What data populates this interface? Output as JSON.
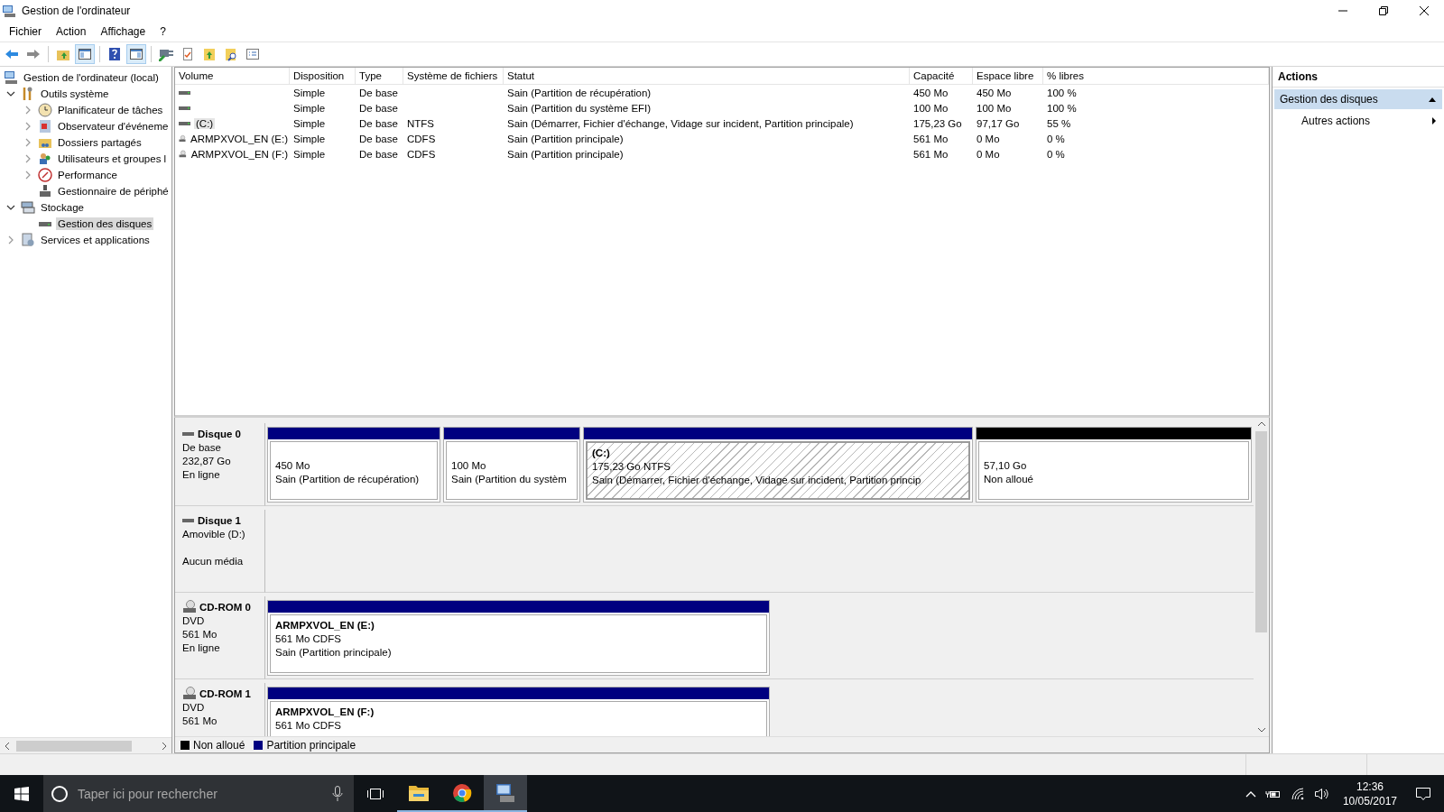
{
  "window": {
    "title": "Gestion de l'ordinateur"
  },
  "menu": [
    "Fichier",
    "Action",
    "Affichage",
    "?"
  ],
  "toolbar": [
    [
      {
        "kind": "back",
        "pressed": false
      },
      {
        "kind": "forward",
        "pressed": false
      }
    ],
    [
      {
        "kind": "up",
        "pressed": false
      },
      {
        "kind": "tree",
        "pressed": true
      }
    ],
    [
      {
        "kind": "help",
        "pressed": false
      },
      {
        "kind": "pane",
        "pressed": true
      }
    ],
    [
      {
        "kind": "connect",
        "pressed": false
      },
      {
        "kind": "check",
        "pressed": false
      },
      {
        "kind": "export",
        "pressed": false
      },
      {
        "kind": "find",
        "pressed": false
      },
      {
        "kind": "props",
        "pressed": false
      }
    ]
  ],
  "tree": [
    {
      "label": "Gestion de l'ordinateur (local)",
      "kind": "computer",
      "selected": false,
      "children": [
        {
          "label": "Outils système",
          "kind": "tools",
          "expanded": true,
          "selected": false,
          "children": [
            {
              "label": "Planificateur de tâches",
              "kind": "clock",
              "expanded": false,
              "selected": false
            },
            {
              "label": "Observateur d'événeme",
              "kind": "event",
              "expanded": false,
              "selected": false
            },
            {
              "label": "Dossiers partagés",
              "kind": "shared",
              "expanded": false,
              "selected": false
            },
            {
              "label": "Utilisateurs et groupes l",
              "kind": "users",
              "expanded": false,
              "selected": false
            },
            {
              "label": "Performance",
              "kind": "performance",
              "expanded": false,
              "selected": false
            },
            {
              "label": "Gestionnaire de périphé",
              "kind": "device",
              "selected": false
            }
          ]
        },
        {
          "label": "Stockage",
          "kind": "storage",
          "expanded": true,
          "selected": false,
          "children": [
            {
              "label": "Gestion des disques",
              "kind": "disk",
              "selected": true
            }
          ]
        },
        {
          "label": "Services et applications",
          "kind": "services",
          "expanded": false,
          "selected": false
        }
      ]
    }
  ],
  "table": {
    "columns": [
      "Volume",
      "Disposition",
      "Type",
      "Système de fichiers",
      "Statut",
      "Capacité",
      "Espace libre",
      "% libres"
    ],
    "rows": [
      {
        "kind": "disk",
        "selected": false,
        "cells": [
          "",
          "Simple",
          "De base",
          "",
          "Sain (Partition de récupération)",
          "450 Mo",
          "450 Mo",
          "100 %"
        ]
      },
      {
        "kind": "disk",
        "selected": false,
        "cells": [
          "",
          "Simple",
          "De base",
          "",
          "Sain (Partition du système EFI)",
          "100 Mo",
          "100 Mo",
          "100 %"
        ]
      },
      {
        "kind": "disk",
        "selected": true,
        "cells": [
          "(C:)",
          "Simple",
          "De base",
          "NTFS",
          "Sain (Démarrer, Fichier d'échange, Vidage sur incident, Partition principale)",
          "175,23 Go",
          "97,17 Go",
          "55 %"
        ]
      },
      {
        "kind": "cdrom",
        "selected": false,
        "cells": [
          "ARMPXVOL_EN (E:)",
          "Simple",
          "De base",
          "CDFS",
          "Sain (Partition principale)",
          "561 Mo",
          "0 Mo",
          "0 %"
        ]
      },
      {
        "kind": "cdrom",
        "selected": false,
        "cells": [
          "ARMPXVOL_EN (F:)",
          "Simple",
          "De base",
          "CDFS",
          "Sain (Partition principale)",
          "561 Mo",
          "0 Mo",
          "0 %"
        ]
      }
    ]
  },
  "disks": [
    {
      "name": "Disque 0",
      "kind": "disk",
      "type": "De base",
      "size": "232,87 Go",
      "status": "En ligne",
      "partitions": [
        {
          "kind": "primary",
          "selected": false,
          "size": "450 Mo",
          "status": "Sain (Partition de récupération)"
        },
        {
          "kind": "primary",
          "selected": false,
          "size": "100 Mo",
          "status": "Sain (Partition du systèm"
        },
        {
          "kind": "primary",
          "selected": true,
          "label": "(C:)",
          "size": "175,23 Go NTFS",
          "status": "Sain (Démarrer, Fichier d'échange, Vidage sur incident, Partition princip"
        },
        {
          "kind": "unallocated",
          "selected": false,
          "size": "57,10 Go",
          "status": "Non alloué"
        }
      ]
    },
    {
      "name": "Disque 1",
      "kind": "disk",
      "type": "Amovible (D:)",
      "status": "Aucun média"
    },
    {
      "name": "CD-ROM 0",
      "kind": "cdrom",
      "type": "DVD",
      "size": "561 Mo",
      "status": "En ligne",
      "partitions": [
        {
          "kind": "primary",
          "selected": false,
          "label": "ARMPXVOL_EN  (E:)",
          "size": "561 Mo CDFS",
          "status": "Sain (Partition principale)"
        }
      ]
    },
    {
      "name": "CD-ROM 1",
      "kind": "cdrom",
      "type": "DVD",
      "size": "561 Mo",
      "partitions": [
        {
          "kind": "primary",
          "selected": false,
          "label": "ARMPXVOL_EN  (F:)",
          "size": "561 Mo CDFS"
        }
      ]
    }
  ],
  "legend": [
    {
      "label": "Non alloué",
      "color": "#000000"
    },
    {
      "label": "Partition principale",
      "color": "#000080"
    }
  ],
  "actions": {
    "title": "Actions",
    "section": "Gestion des disques",
    "items": [
      "Autres actions"
    ]
  },
  "taskbar": {
    "search": {
      "placeholder": "Taper ici pour rechercher"
    },
    "apps": [
      {
        "kind": "folder",
        "running": true,
        "active": false
      },
      {
        "kind": "browser",
        "running": true,
        "active": false
      },
      {
        "kind": "computer",
        "running": true,
        "active": true
      }
    ],
    "time": "12:36",
    "date": "10/05/2017"
  }
}
